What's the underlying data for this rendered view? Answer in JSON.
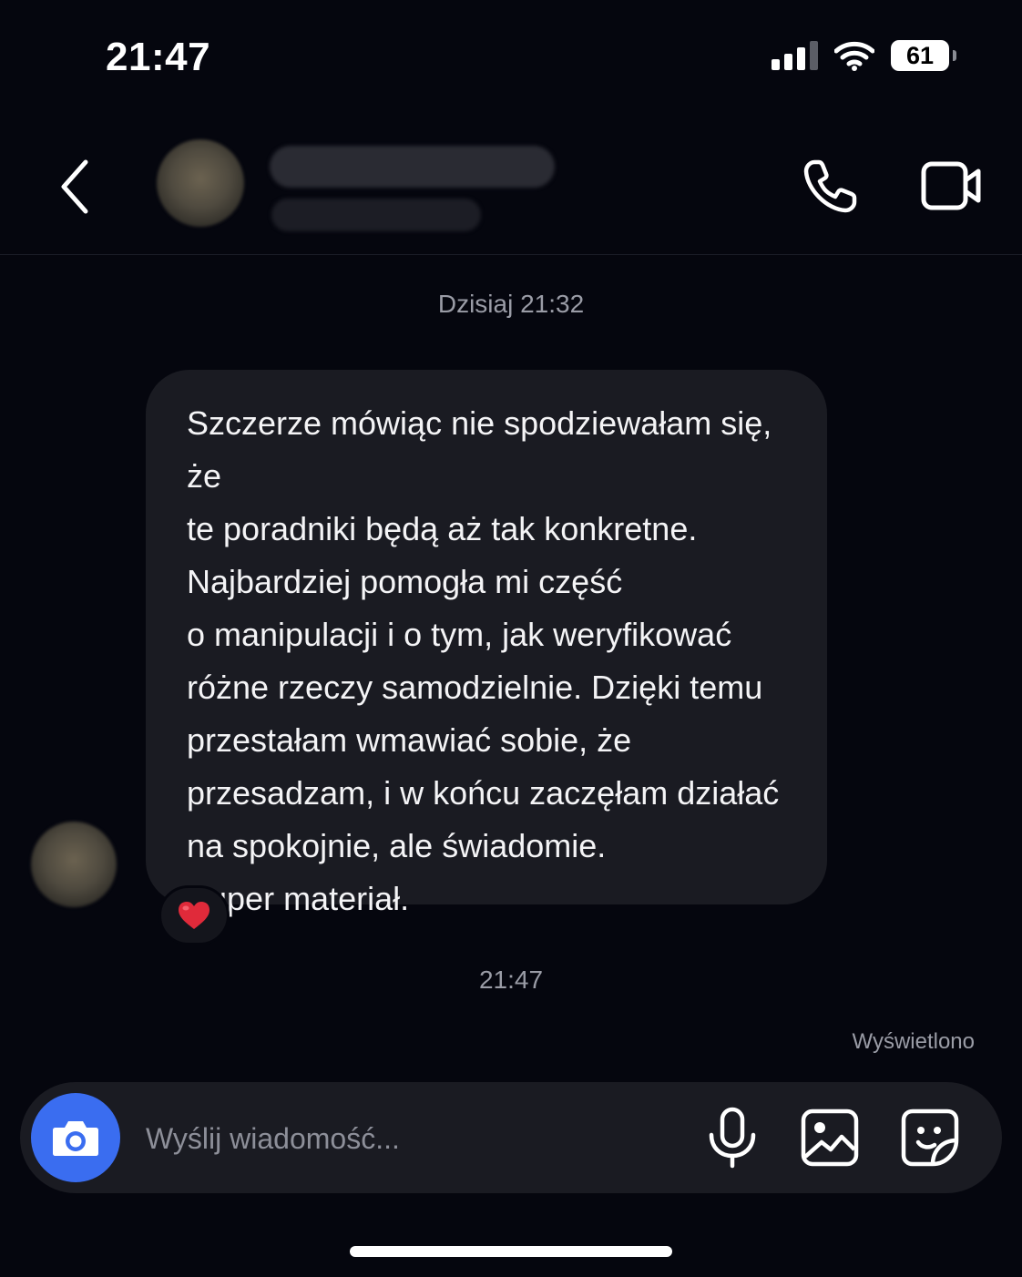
{
  "status_bar": {
    "time": "21:47",
    "battery": "61",
    "icons": [
      "cellular-signal-icon",
      "wifi-icon",
      "battery-icon"
    ]
  },
  "header": {
    "icons": [
      "chevron-left-icon",
      "phone-icon",
      "video-camera-icon"
    ]
  },
  "chat": {
    "date_separator": "Dzisiaj 21:32",
    "message_text": "Szczerze mówiąc nie spodziewałam się, że\nte poradniki będą aż tak konkretne.\nNajbardziej pomogła mi część\no manipulacji i o tym, jak weryfikować\nróżne rzeczy samodzielnie. Dzięki temu\nprzestałam wmawiać sobie, że\nprzesadzam, i w końcu zaczęłam działać\nna spokojnie, ale świadomie.\nSuper materiał.",
    "reaction": "heart-emoji",
    "time_separator": "21:47",
    "seen_status": "Wyświetlono"
  },
  "composer": {
    "placeholder": "Wyślij wiadomość...",
    "value": "",
    "icons": [
      "camera-icon",
      "microphone-icon",
      "image-icon",
      "sticker-icon"
    ]
  },
  "colors": {
    "background": "#05060e",
    "bubble": "#1a1b22",
    "camera_button": "#3a6df0",
    "muted_text": "#9a9ca6",
    "heart": "#e02a3a"
  }
}
